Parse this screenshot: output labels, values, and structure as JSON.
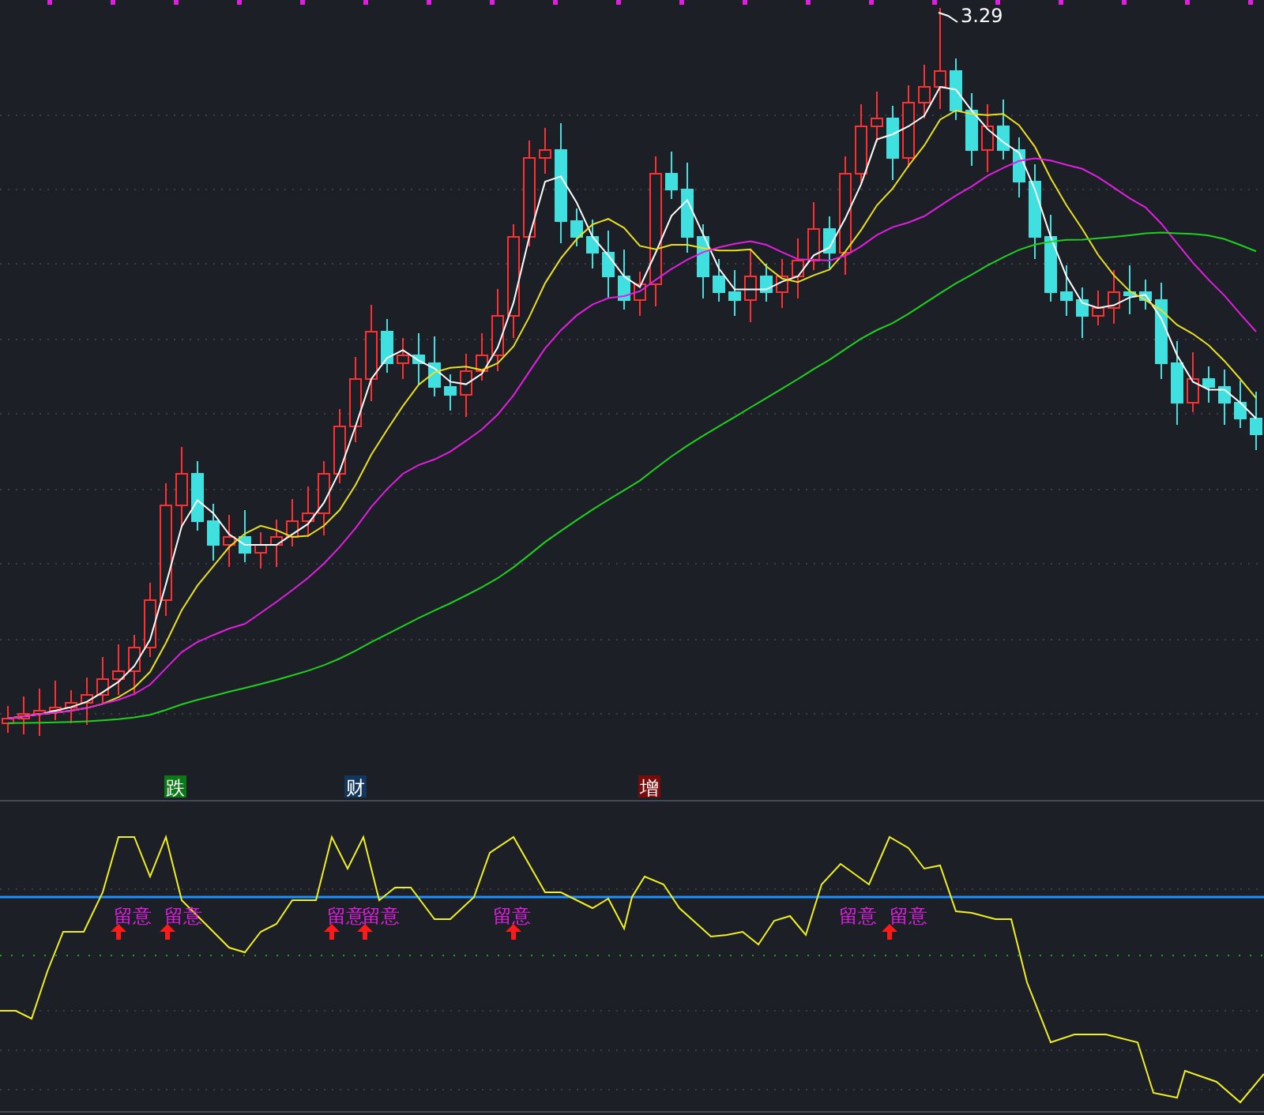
{
  "price_label": "3.29",
  "signals": [
    {
      "label": "跌",
      "color": "#0b7a16"
    },
    {
      "label": "财",
      "color": "#12365e"
    },
    {
      "label": "增",
      "color": "#7a0b0b"
    }
  ],
  "alerts": [
    {
      "label": "留意",
      "arrow": true
    },
    {
      "label": "留意",
      "arrow": true
    },
    {
      "label": "留意",
      "arrow": true
    },
    {
      "label": "留意",
      "arrow": true
    },
    {
      "label": "留意",
      "arrow": true
    },
    {
      "label": "留意",
      "arrow": false
    },
    {
      "label": "留意",
      "arrow": true
    }
  ]
}
